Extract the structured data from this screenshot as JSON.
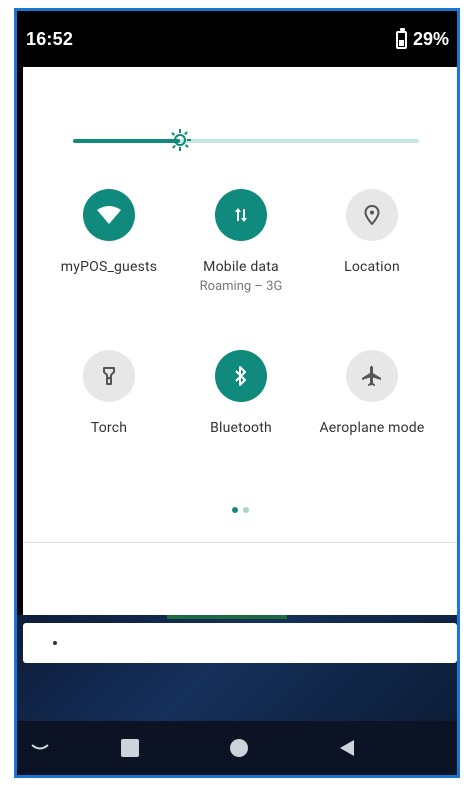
{
  "status_bar": {
    "time": "16:52",
    "battery_percent": "29%"
  },
  "brightness": {
    "level_fraction": 0.31,
    "accent_color": "#0f8a7c"
  },
  "tiles": [
    {
      "id": "wifi",
      "label": "myPOS_guests",
      "sublabel": "",
      "state": "on",
      "icon": "wifi-icon"
    },
    {
      "id": "mobile-data",
      "label": "Mobile data",
      "sublabel": "Roaming – 3G",
      "state": "on",
      "icon": "data-arrows-icon"
    },
    {
      "id": "location",
      "label": "Location",
      "sublabel": "",
      "state": "off",
      "icon": "location-pin-icon"
    },
    {
      "id": "torch",
      "label": "Torch",
      "sublabel": "",
      "state": "off",
      "icon": "torch-icon"
    },
    {
      "id": "bluetooth",
      "label": "Bluetooth",
      "sublabel": "",
      "state": "on",
      "icon": "bluetooth-icon"
    },
    {
      "id": "aeroplane",
      "label": "Aeroplane mode",
      "sublabel": "",
      "state": "off",
      "icon": "airplane-icon"
    }
  ],
  "pager": {
    "current_page": 1,
    "total_pages": 2
  },
  "colors": {
    "tile_on": "#0f8a7c",
    "tile_off": "#e7e7e7",
    "frame_border": "#1976d2"
  },
  "navigation": {
    "buttons": [
      "collapse",
      "recents",
      "home",
      "back"
    ]
  }
}
